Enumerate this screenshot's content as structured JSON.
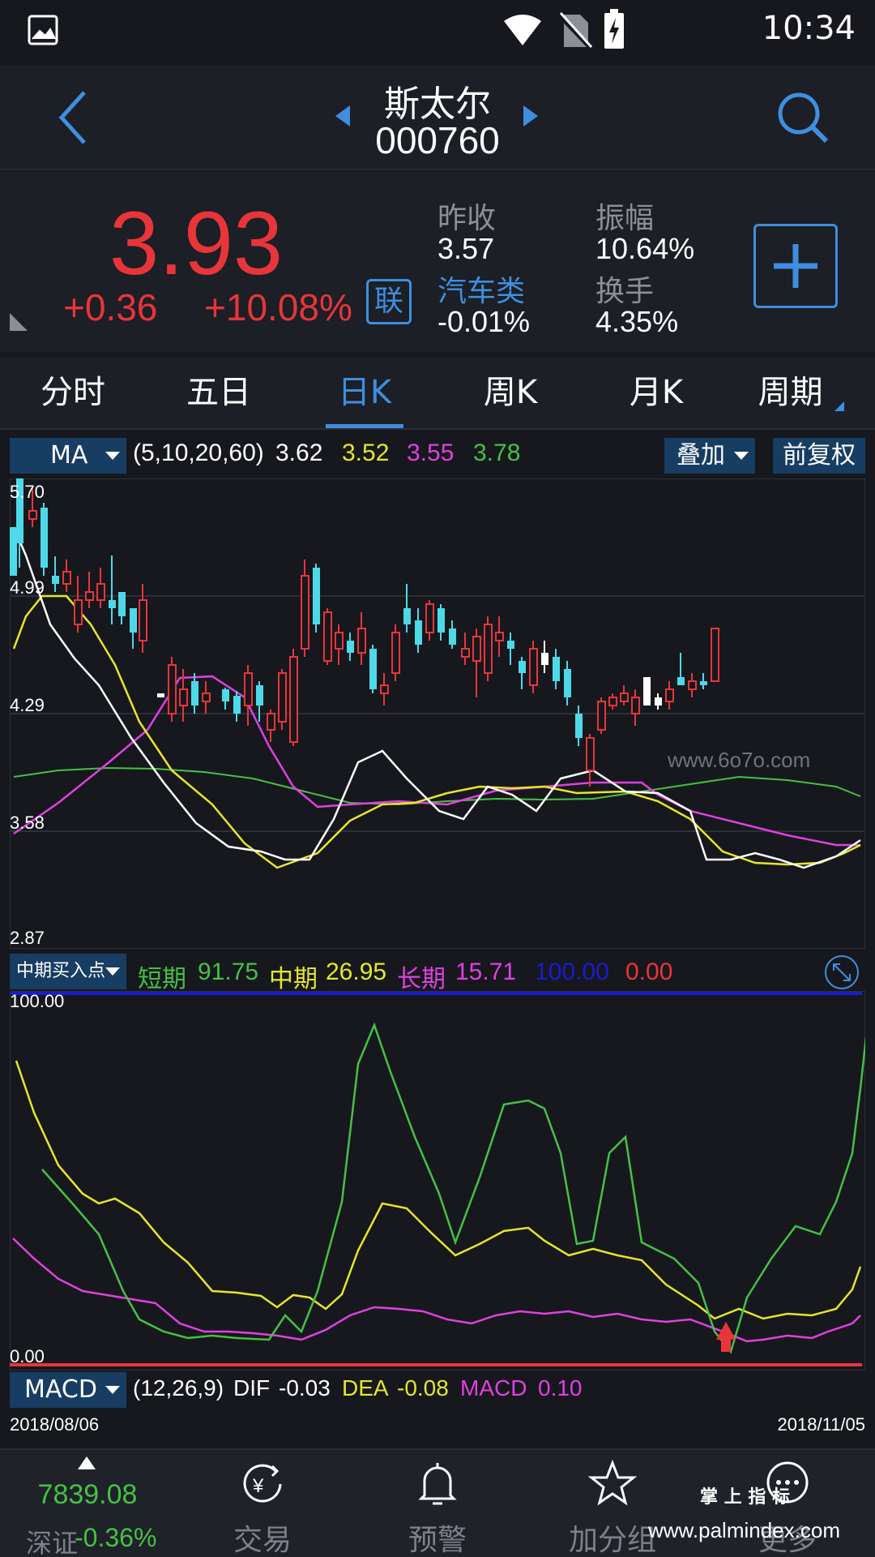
{
  "status": {
    "time": "10:34"
  },
  "header": {
    "name": "斯太尔",
    "code": "000760"
  },
  "quote": {
    "price": "3.93",
    "change": "+0.36",
    "change_pct": "+10.08%",
    "lian_badge": "联",
    "prev_close_label": "昨收",
    "prev_close": "3.57",
    "amplitude_label": "振幅",
    "amplitude": "10.64%",
    "sector_label": "汽车类",
    "sector_change": "-0.01%",
    "turnover_label": "换手",
    "turnover": "4.35%"
  },
  "tabs": [
    {
      "label": "分时"
    },
    {
      "label": "五日"
    },
    {
      "label": "日K"
    },
    {
      "label": "周K"
    },
    {
      "label": "月K"
    },
    {
      "label": "周期"
    }
  ],
  "ma_bar": {
    "selector": "MA",
    "params": "(5,10,20,60)",
    "v1": "3.62",
    "v2": "3.52",
    "v3": "3.55",
    "v4": "3.78",
    "overlay_label": "叠加",
    "adjust_label": "前复权"
  },
  "price_axis": {
    "top": "5.70",
    "l2": "4.99",
    "l3": "4.29",
    "l4": "3.58",
    "bottom": "2.87"
  },
  "watermark_mid": "www.6o7o.com",
  "indicator_bar": {
    "selector": "中期买入点",
    "short_label": "短期",
    "short_value": "91.75",
    "mid_label": "中期",
    "mid_value": "26.95",
    "long_label": "长期",
    "long_value": "15.71",
    "v_blue": "100.00",
    "v_red": "0.00"
  },
  "indicator_axis": {
    "top": "100.00",
    "bottom": "0.00"
  },
  "macd_bar": {
    "selector": "MACD",
    "params": "(12,26,9)",
    "dif_label": "DIF",
    "dif": "-0.03",
    "dea_label": "DEA",
    "dea": "-0.08",
    "macd_label": "MACD",
    "macd": "0.10"
  },
  "dates": {
    "start": "2018/08/06",
    "end": "2018/11/05"
  },
  "nav": {
    "index_value": "7839.08",
    "index_name": "深证",
    "index_change": "-0.36%",
    "items": [
      {
        "label": "交易"
      },
      {
        "label": "预警"
      },
      {
        "label": "加分组"
      },
      {
        "label": "更多"
      }
    ]
  },
  "watermark_bottom": {
    "top": "掌 上 指 标",
    "url": "www.palmindex.com"
  },
  "colors": {
    "up": "#e8353a",
    "down": "#4dd9e8",
    "accent": "#3f8ee0",
    "ma5": "#ffffff",
    "ma10": "#e6e62a",
    "ma20": "#e040e0",
    "ma60": "#46c046"
  }
}
